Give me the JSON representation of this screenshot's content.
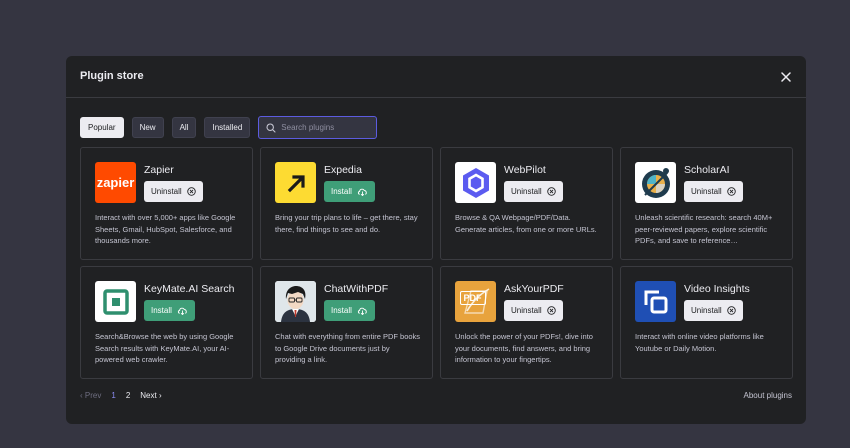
{
  "modal": {
    "title": "Plugin store"
  },
  "filters": {
    "tabs": [
      {
        "label": "Popular",
        "active": true
      },
      {
        "label": "New",
        "active": false
      },
      {
        "label": "All",
        "active": false
      },
      {
        "label": "Installed",
        "active": false
      }
    ],
    "search_placeholder": "Search plugins"
  },
  "plugins": [
    {
      "name": "Zapier",
      "action": "Uninstall",
      "description": "Interact with over 5,000+ apps like Google Sheets, Gmail, HubSpot, Salesforce, and thousands more.",
      "logo_text": "zapier"
    },
    {
      "name": "Expedia",
      "action": "Install",
      "description": "Bring your trip plans to life – get there, stay there, find things to see and do.",
      "logo_text": ""
    },
    {
      "name": "WebPilot",
      "action": "Uninstall",
      "description": "Browse & QA Webpage/PDF/Data. Generate articles, from one or more URLs.",
      "logo_text": ""
    },
    {
      "name": "ScholarAI",
      "action": "Uninstall",
      "description": "Unleash scientific research: search 40M+ peer-reviewed papers, explore scientific PDFs, and save to reference…",
      "logo_text": ""
    },
    {
      "name": "KeyMate.AI Search",
      "action": "Install",
      "description": "Search&Browse the web by using Google Search results with KeyMate.AI, your AI-powered web crawler.",
      "logo_text": ""
    },
    {
      "name": "ChatWithPDF",
      "action": "Install",
      "description": "Chat with everything from entire PDF books to Google Drive documents just by providing a link.",
      "logo_text": ""
    },
    {
      "name": "AskYourPDF",
      "action": "Uninstall",
      "description": "Unlock the power of your PDFs!, dive into your documents, find answers, and bring information to your fingertips.",
      "logo_text": "PDF"
    },
    {
      "name": "Video Insights",
      "action": "Uninstall",
      "description": "Interact with online video platforms like Youtube or Daily Motion.",
      "logo_text": ""
    }
  ],
  "pagination": {
    "prev": "Prev",
    "pages": [
      "1",
      "2"
    ],
    "current": "1",
    "next": "Next"
  },
  "footer": {
    "about": "About plugins"
  },
  "colors": {
    "accent": "#5c5ce0",
    "install": "#3f9e78",
    "modal_bg": "#202123",
    "page_bg": "#353541"
  }
}
